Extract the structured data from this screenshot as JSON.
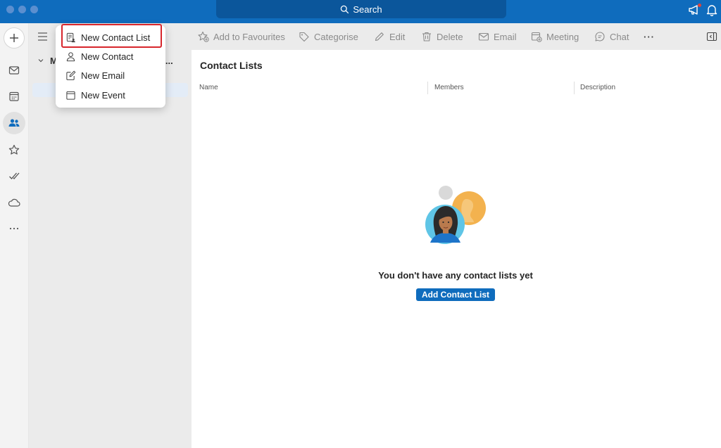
{
  "titlebar": {
    "search_label": "Search"
  },
  "rail": {
    "new_button": "+",
    "items": [
      {
        "name": "mail",
        "icon": "mail-icon"
      },
      {
        "name": "calendar",
        "icon": "calendar-icon"
      },
      {
        "name": "people",
        "icon": "people-icon",
        "active": true
      },
      {
        "name": "favourites",
        "icon": "star-icon"
      },
      {
        "name": "to-do",
        "icon": "checkmark-icon"
      },
      {
        "name": "onedrive",
        "icon": "cloud-icon"
      },
      {
        "name": "more-apps",
        "icon": "more-icon"
      }
    ]
  },
  "folders": {
    "group_label": "M",
    "group_truncation": "..."
  },
  "toolbar": {
    "add_to_favourites": "Add to Favourites",
    "categorise": "Categorise",
    "edit": "Edit",
    "delete": "Delete",
    "email": "Email",
    "meeting": "Meeting",
    "chat": "Chat",
    "more": "···"
  },
  "main": {
    "title": "Contact Lists",
    "columns": [
      "Name",
      "Members",
      "Description"
    ],
    "empty_message": "You don't have any contact lists yet",
    "add_button": "Add Contact List"
  },
  "menu": {
    "items": [
      {
        "label": "New Contact List",
        "icon": "contact-list-icon"
      },
      {
        "label": "New Contact",
        "icon": "person-icon"
      },
      {
        "label": "New Email",
        "icon": "compose-icon"
      },
      {
        "label": "New Event",
        "icon": "calendar-icon"
      }
    ]
  },
  "colors": {
    "accent": "#0f6cbd",
    "highlight": "#d7262c"
  }
}
